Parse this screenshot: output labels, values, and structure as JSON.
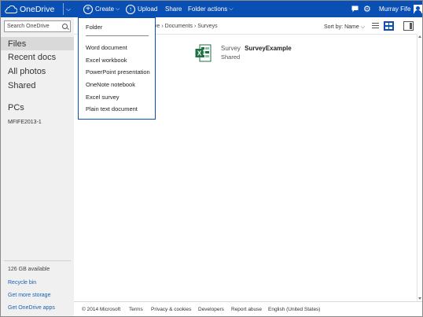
{
  "app": {
    "title": "OneDrive"
  },
  "topbar": {
    "create_label": "Create",
    "upload_label": "Upload",
    "share_label": "Share",
    "folder_actions_label": "Folder actions",
    "user_name": "Murray Fife"
  },
  "sidebar": {
    "search_placeholder": "Search OneDrive",
    "nav": [
      "Files",
      "Recent docs",
      "All photos",
      "Shared"
    ],
    "pcs_heading": "PCs",
    "pc_name": "MFIFE2013-1",
    "storage": "126 GB available",
    "recycle_bin": "Recycle bin",
    "get_storage": "Get more storage",
    "get_apps": "Get OneDrive apps"
  },
  "breadcrumb": [
    "ve",
    "Documents",
    "Surveys"
  ],
  "sort_label": "Sort by: Name",
  "file": {
    "prefix": "Survey",
    "name": "SurveyExample",
    "status": "Shared"
  },
  "create_menu": {
    "items": [
      "Folder",
      "Word document",
      "Excel workbook",
      "PowerPoint presentation",
      "OneNote notebook",
      "Excel survey",
      "Plain text document"
    ]
  },
  "footer": [
    "© 2014 Microsoft",
    "Terms",
    "Privacy & cookies",
    "Developers",
    "Report abuse",
    "English (United States)"
  ],
  "colors": {
    "accent": "#0a4fb3",
    "link": "#1a5fb4",
    "excel_green": "#1e7145"
  }
}
